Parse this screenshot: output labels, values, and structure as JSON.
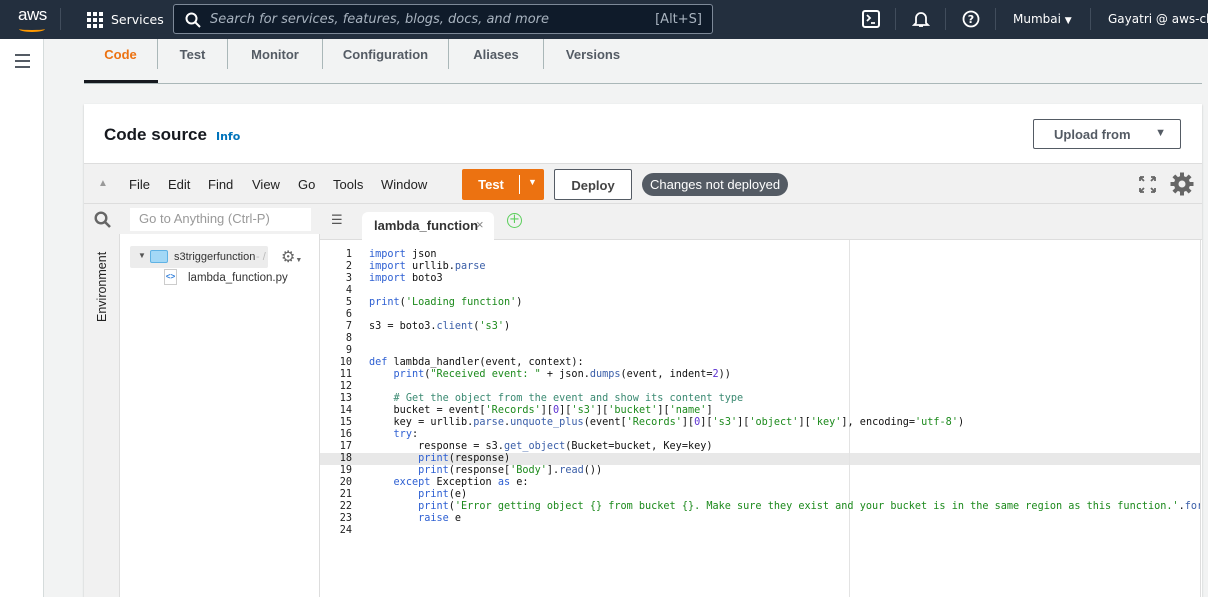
{
  "topnav": {
    "logo": "aws",
    "services": "Services",
    "search_placeholder": "Search for services, features, blogs, docs, and more",
    "search_shortcut": "[Alt+S]",
    "region": "Mumbai",
    "user": "Gayatri @ aws-clo"
  },
  "tabs": [
    "Code",
    "Test",
    "Monitor",
    "Configuration",
    "Aliases",
    "Versions"
  ],
  "panel": {
    "title": "Code source",
    "info": "Info",
    "upload": "Upload from"
  },
  "toolbar": {
    "menus": [
      "File",
      "Edit",
      "Find",
      "View",
      "Go",
      "Tools",
      "Window"
    ],
    "test": "Test",
    "deploy": "Deploy",
    "status": "Changes not deployed"
  },
  "sidebar": {
    "goto_placeholder": "Go to Anything (Ctrl-P)",
    "env_tab": "Environment",
    "folder": "s3triggerfunction",
    "folder_suffix": " - /",
    "file": "lambda_function.py"
  },
  "editor": {
    "tab": "lambda_function",
    "highlighted_line": 18,
    "lines": [
      [
        [
          "import",
          "k"
        ],
        [
          " json",
          ""
        ]
      ],
      [
        [
          "import",
          "k"
        ],
        [
          " urllib.",
          ""
        ],
        [
          "parse",
          "f"
        ]
      ],
      [
        [
          "import",
          "k"
        ],
        [
          " boto3",
          ""
        ]
      ],
      [],
      [
        [
          "print",
          "k"
        ],
        [
          "(",
          ""
        ],
        [
          "'Loading function'",
          "s"
        ],
        [
          ")",
          ""
        ]
      ],
      [],
      [
        [
          "s3 = boto3.",
          ""
        ],
        [
          "client",
          "f"
        ],
        [
          "(",
          ""
        ],
        [
          "'s3'",
          "s"
        ],
        [
          ")",
          ""
        ]
      ],
      [],
      [],
      [
        [
          "def",
          "k"
        ],
        [
          " lambda_handler(event, context):",
          ""
        ]
      ],
      [
        [
          "    ",
          ""
        ],
        [
          "print",
          "k"
        ],
        [
          "(",
          ""
        ],
        [
          "\"Received event: \"",
          "s"
        ],
        [
          " + json.",
          ""
        ],
        [
          "dumps",
          "f"
        ],
        [
          "(event, indent=",
          ""
        ],
        [
          "2",
          "n"
        ],
        [
          "))",
          ""
        ]
      ],
      [],
      [
        [
          "    ",
          ""
        ],
        [
          "# Get the object from the event and show its content type",
          "c"
        ]
      ],
      [
        [
          "    bucket = event[",
          ""
        ],
        [
          "'Records'",
          "s"
        ],
        [
          "][",
          ""
        ],
        [
          "0",
          "n"
        ],
        [
          "][",
          ""
        ],
        [
          "'s3'",
          "s"
        ],
        [
          "][",
          ""
        ],
        [
          "'bucket'",
          "s"
        ],
        [
          "][",
          ""
        ],
        [
          "'name'",
          "s"
        ],
        [
          "]",
          ""
        ]
      ],
      [
        [
          "    key = urllib.",
          ""
        ],
        [
          "parse",
          "f"
        ],
        [
          ".",
          ""
        ],
        [
          "unquote_plus",
          "f"
        ],
        [
          "(event[",
          ""
        ],
        [
          "'Records'",
          "s"
        ],
        [
          "][",
          ""
        ],
        [
          "0",
          "n"
        ],
        [
          "][",
          ""
        ],
        [
          "'s3'",
          "s"
        ],
        [
          "][",
          ""
        ],
        [
          "'object'",
          "s"
        ],
        [
          "][",
          ""
        ],
        [
          "'key'",
          "s"
        ],
        [
          "], encoding=",
          ""
        ],
        [
          "'utf-8'",
          "s"
        ],
        [
          ")",
          ""
        ]
      ],
      [
        [
          "    ",
          ""
        ],
        [
          "try",
          "k"
        ],
        [
          ":",
          ""
        ]
      ],
      [
        [
          "        response = s3.",
          ""
        ],
        [
          "get_object",
          "f"
        ],
        [
          "(Bucket=bucket, Key=key)",
          ""
        ]
      ],
      [
        [
          "        ",
          ""
        ],
        [
          "print",
          "k"
        ],
        [
          "(response)",
          ""
        ]
      ],
      [
        [
          "        ",
          ""
        ],
        [
          "print",
          "k"
        ],
        [
          "(response[",
          ""
        ],
        [
          "'Body'",
          "s"
        ],
        [
          "].",
          ""
        ],
        [
          "read",
          "f"
        ],
        [
          "())",
          ""
        ]
      ],
      [
        [
          "    ",
          ""
        ],
        [
          "except",
          "k"
        ],
        [
          " Exception ",
          ""
        ],
        [
          "as",
          "k"
        ],
        [
          " e:",
          ""
        ]
      ],
      [
        [
          "        ",
          ""
        ],
        [
          "print",
          "k"
        ],
        [
          "(e)",
          ""
        ]
      ],
      [
        [
          "        ",
          ""
        ],
        [
          "print",
          "k"
        ],
        [
          "(",
          ""
        ],
        [
          "'Error getting object {} from bucket {}. Make sure they exist and your bucket is in the same region as this function.'",
          "s"
        ],
        [
          ".",
          ""
        ],
        [
          "format",
          "f"
        ]
      ],
      [
        [
          "        ",
          ""
        ],
        [
          "raise",
          "k"
        ],
        [
          " e",
          ""
        ]
      ],
      []
    ]
  }
}
